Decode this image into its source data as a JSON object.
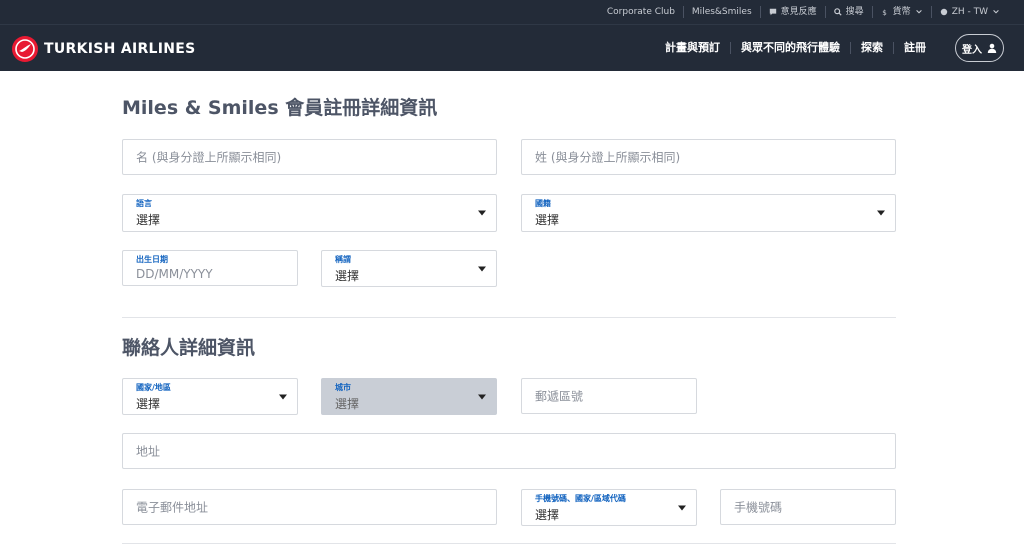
{
  "topbar": {
    "items": [
      "Corporate Club",
      "Miles&Smiles",
      "意見反應",
      "搜尋",
      "貨幣",
      "ZH - TW"
    ]
  },
  "navbar": {
    "brand": "TURKISH AIRLINES",
    "links": [
      "計畫與預訂",
      "與眾不同的飛行體驗",
      "探索",
      "註冊"
    ],
    "login": "登入"
  },
  "form": {
    "title": "Miles & Smiles 會員註冊詳細資訊",
    "first_name_placeholder": "名 (與身分證上所顯示相同)",
    "last_name_placeholder": "姓 (與身分證上所顯示相同)",
    "language": {
      "label": "語言",
      "value": "選擇"
    },
    "nationality": {
      "label": "國籍",
      "value": "選擇"
    },
    "birthdate": {
      "label": "出生日期",
      "placeholder": "DD/MM/YYYY"
    },
    "title_field": {
      "label": "稱謂",
      "value": "選擇"
    }
  },
  "contact": {
    "title": "聯絡人詳細資訊",
    "country": {
      "label": "國家/地區",
      "value": "選擇"
    },
    "city": {
      "label": "城市",
      "value": "選擇"
    },
    "postal_placeholder": "郵遞區號",
    "address_placeholder": "地址",
    "email_placeholder": "電子郵件地址",
    "phone_code": {
      "label": "手機號碼、國家/區域代碼",
      "value": "選擇"
    },
    "phone_placeholder": "手機號碼"
  },
  "colors": {
    "nav_bg": "#232b38",
    "brand_red": "#e81932",
    "label_blue": "#1565c0"
  }
}
